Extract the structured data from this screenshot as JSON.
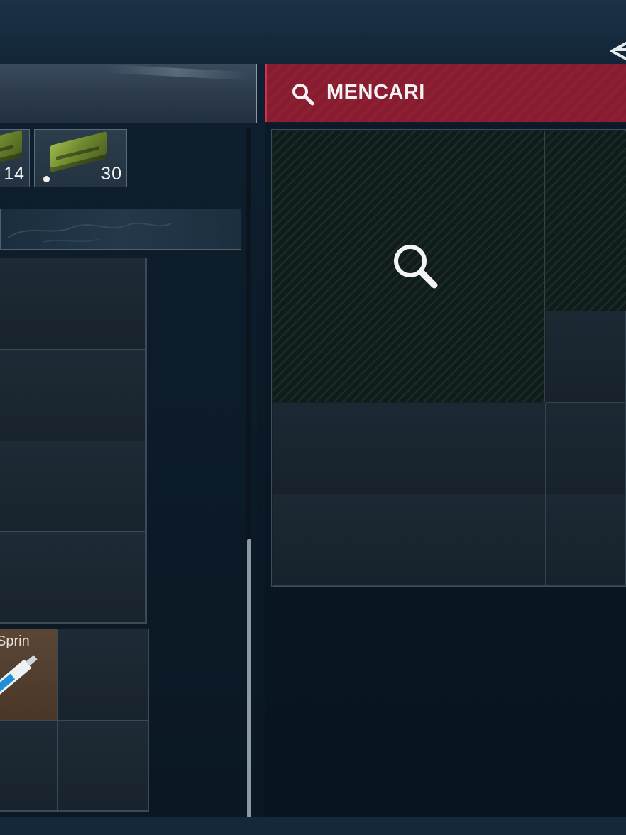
{
  "colors": {
    "search_header": "#8e1f33",
    "search_accent": "#d0304a",
    "ammo_green": "#9db84a",
    "item_rarity": "#5b4636",
    "scrollbar": "#8c9aa7"
  },
  "left_panel": {
    "ammo": [
      {
        "count": "14",
        "icon": "ammo-box-icon"
      },
      {
        "count": "30",
        "icon": "ammo-box-icon"
      }
    ],
    "backpack_item": {
      "label": "Sprin",
      "icon": "syringe-icon"
    }
  },
  "right_panel": {
    "header": {
      "label": "MENCARI",
      "icon": "search-icon"
    },
    "searching_icon": "search-icon"
  }
}
